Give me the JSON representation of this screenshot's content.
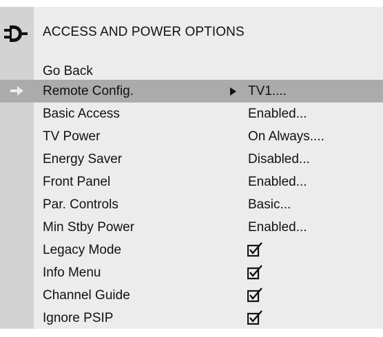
{
  "menu": {
    "title": "ACCESS AND POWER OPTIONS",
    "icon": "plug-icon",
    "items": [
      {
        "label": "Go Back",
        "value": ""
      },
      {
        "label": "Remote Config.",
        "value": "TV1....",
        "selected": true,
        "has_submenu": true
      },
      {
        "label": "Basic Access",
        "value": "Enabled..."
      },
      {
        "label": "TV Power",
        "value": "On Always...."
      },
      {
        "label": "Energy Saver",
        "value": "Disabled..."
      },
      {
        "label": "Front Panel",
        "value": "Enabled..."
      },
      {
        "label": "Par. Controls",
        "value": "Basic..."
      },
      {
        "label": "Min Stby Power",
        "value": "Enabled..."
      },
      {
        "label": "Legacy Mode",
        "checked": true
      },
      {
        "label": "Info Menu",
        "checked": true
      },
      {
        "label": "Channel Guide",
        "checked": true
      },
      {
        "label": "Ignore PSIP",
        "checked": true
      }
    ]
  },
  "colors": {
    "menu_background": "#ececec",
    "sidebar": "#d3d3d3",
    "selected_row": "#ababab",
    "text": "#111111"
  }
}
